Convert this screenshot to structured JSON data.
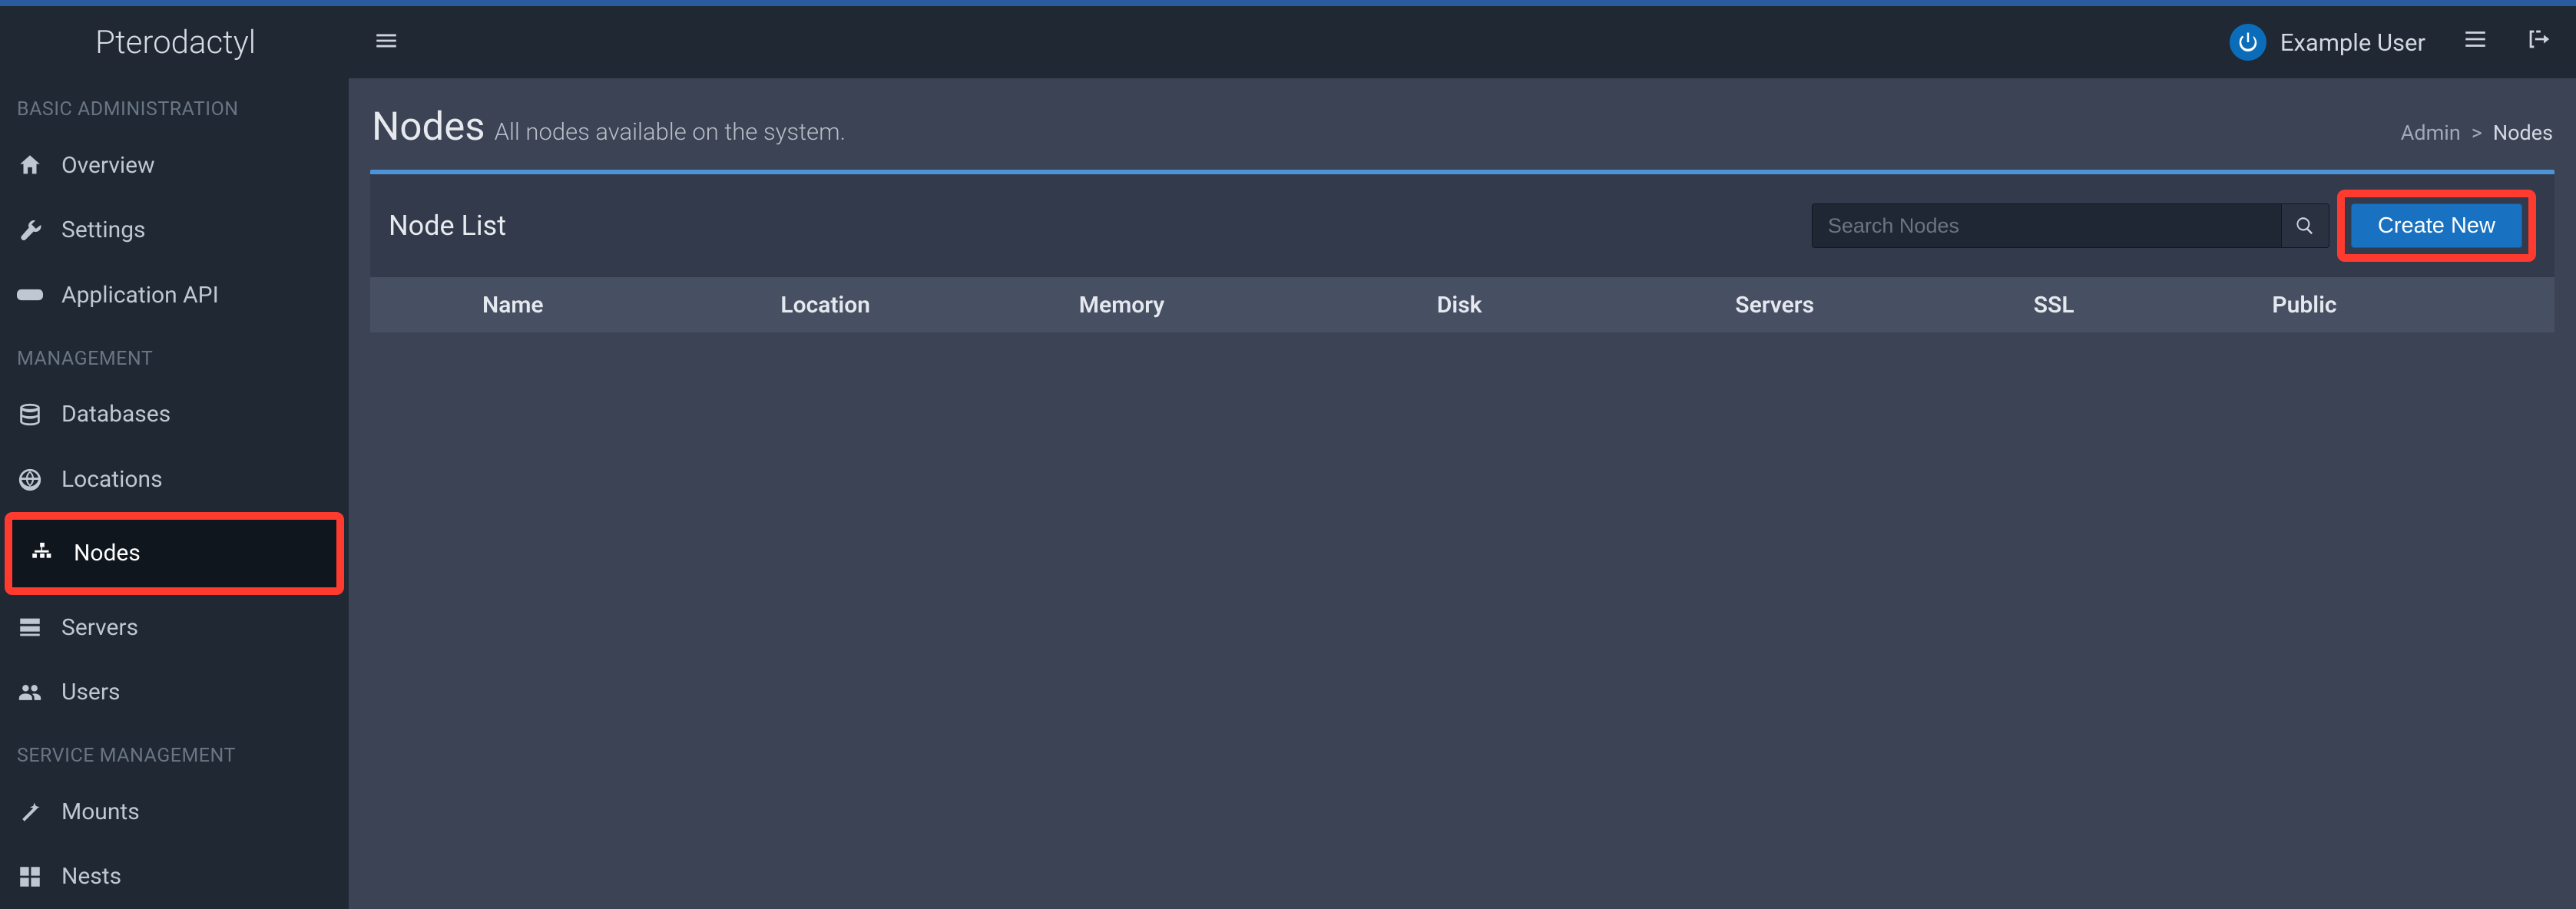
{
  "brand": "Pterodactyl",
  "user_name": "Example User",
  "sidebar": {
    "sections": [
      {
        "label": "BASIC ADMINISTRATION",
        "items": [
          {
            "label": "Overview",
            "icon": "home-icon"
          },
          {
            "label": "Settings",
            "icon": "wrench-icon"
          },
          {
            "label": "Application API",
            "icon": "gamepad-icon"
          }
        ]
      },
      {
        "label": "MANAGEMENT",
        "items": [
          {
            "label": "Databases",
            "icon": "database-icon"
          },
          {
            "label": "Locations",
            "icon": "globe-icon"
          },
          {
            "label": "Nodes",
            "icon": "sitemap-icon"
          },
          {
            "label": "Servers",
            "icon": "server-icon"
          },
          {
            "label": "Users",
            "icon": "users-icon"
          }
        ]
      },
      {
        "label": "SERVICE MANAGEMENT",
        "items": [
          {
            "label": "Mounts",
            "icon": "magic-icon"
          },
          {
            "label": "Nests",
            "icon": "grid-icon"
          }
        ]
      }
    ]
  },
  "page": {
    "title": "Nodes",
    "subtitle": "All nodes available on the system.",
    "breadcrumb": {
      "root": "Admin",
      "current": "Nodes",
      "sep": ">"
    }
  },
  "panel": {
    "title": "Node List",
    "search_placeholder": "Search Nodes",
    "create_label": "Create New",
    "columns": {
      "c0": "",
      "c1": "Name",
      "c2": "Location",
      "c3": "Memory",
      "c4": "Disk",
      "c5": "Servers",
      "c6": "SSL",
      "c7": "Public"
    },
    "rows": []
  }
}
